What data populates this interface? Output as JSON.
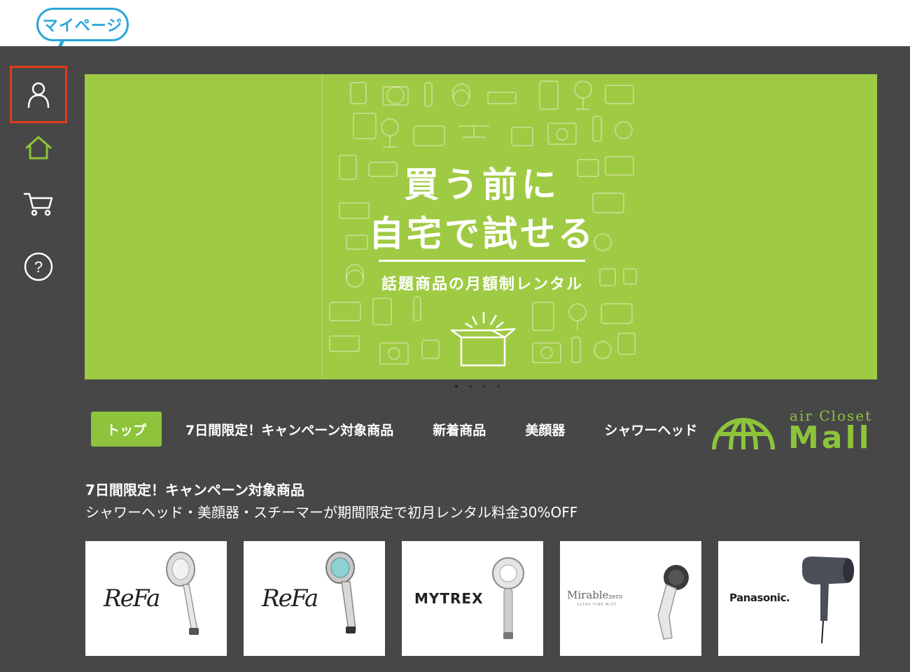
{
  "callout": {
    "label": "マイページ",
    "color": "#2aa6d8"
  },
  "colors": {
    "background": "#474747",
    "accent": "#8dc43b",
    "banner": "#9fca43",
    "highlight": "#e2391c"
  },
  "sidebar": {
    "items": [
      {
        "icon": "user-icon",
        "highlighted": true
      },
      {
        "icon": "home-icon",
        "active": true
      },
      {
        "icon": "cart-icon"
      },
      {
        "icon": "help-icon"
      }
    ]
  },
  "banner": {
    "headline_1": "買う前に",
    "headline_2": "自宅で試せる",
    "subline": "話題商品の月額制レンタル",
    "slide_count": 4,
    "active_slide": 1
  },
  "nav": {
    "tabs": [
      {
        "label": "トップ",
        "active": true
      },
      {
        "label": "7日間限定！キャンペーン対象商品"
      },
      {
        "label": "新着商品"
      },
      {
        "label": "美顔器"
      },
      {
        "label": "シャワーヘッド"
      }
    ]
  },
  "logo": {
    "top": "air Closet",
    "main": "Mall"
  },
  "section": {
    "title": "7日間限定！キャンペーン対象商品",
    "description": "シャワーヘッド・美顔器・スチーマーが期間限定で初月レンタル料金30%OFF"
  },
  "products": [
    {
      "brand": "ReFa"
    },
    {
      "brand": "ReFa"
    },
    {
      "brand": "MYTREX"
    },
    {
      "brand": "Mirable",
      "brand_mark": "zero",
      "tagline": "ULTRA FINE MIST"
    },
    {
      "brand": "Panasonic."
    }
  ]
}
